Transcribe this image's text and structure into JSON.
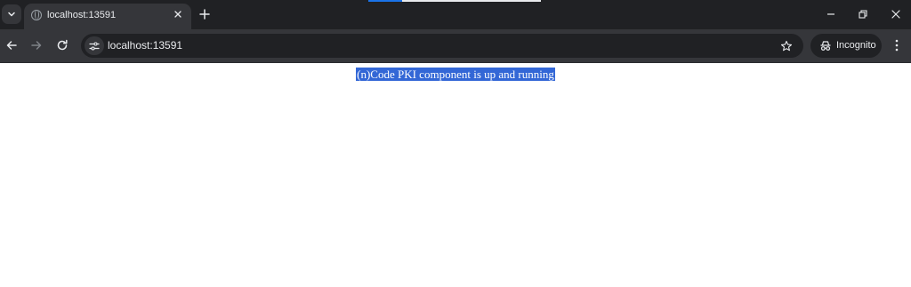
{
  "window": {
    "tab_title": "localhost:13591",
    "address": "localhost:13591",
    "incognito_label": "Incognito"
  },
  "icons": {
    "tab_search": "chevron-down-icon",
    "tab_favicon": "globe-icon",
    "tab_close": "close-icon",
    "new_tab": "plus-icon",
    "minimize": "minimize-icon",
    "restore": "restore-icon",
    "close_window": "close-icon",
    "back": "arrow-left-icon",
    "forward": "arrow-right-icon",
    "reload": "reload-icon",
    "site_info": "tune-icon",
    "bookmark": "star-icon",
    "incognito": "incognito-icon",
    "menu": "kebab-menu-icon"
  },
  "colors": {
    "tabstrip_bg": "#202124",
    "toolbar_bg": "#35363a",
    "selection_bg": "#3367d6",
    "text_light": "#e8eaed"
  },
  "page": {
    "message": "(n)Code PKI component is up and running"
  }
}
